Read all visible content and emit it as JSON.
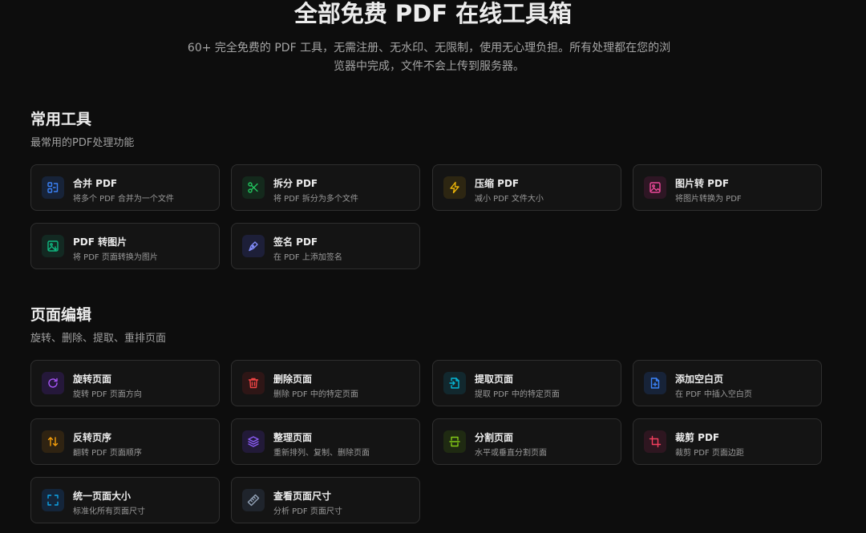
{
  "hero": {
    "title": "全部免费 PDF 在线工具箱",
    "subtitle_line1": "60+ 完全免费的 PDF 工具，无需注册、无水印、无限制，使用无心理负担。所有处理都在您的浏",
    "subtitle_line2": "览器中完成，文件不会上传到服务器。"
  },
  "sections": [
    {
      "title": "常用工具",
      "desc": "最常用的PDF处理功能",
      "tools": [
        {
          "name": "合并 PDF",
          "desc": "将多个 PDF 合并为一个文件",
          "icon": "merge-icon",
          "color": "#3b82f6",
          "bg": "#172338"
        },
        {
          "name": "拆分 PDF",
          "desc": "将 PDF 拆分为多个文件",
          "icon": "scissors-icon",
          "color": "#22c55e",
          "bg": "#14291c"
        },
        {
          "name": "压缩 PDF",
          "desc": "减小 PDF 文件大小",
          "icon": "lightning-icon",
          "color": "#eab308",
          "bg": "#2d2612"
        },
        {
          "name": "图片转 PDF",
          "desc": "将图片转换为 PDF",
          "icon": "image-icon",
          "color": "#ec4899",
          "bg": "#2e1624"
        },
        {
          "name": "PDF 转图片",
          "desc": "将 PDF 页面转换为图片",
          "icon": "image-export-icon",
          "color": "#10b981",
          "bg": "#132922"
        },
        {
          "name": "签名 PDF",
          "desc": "在 PDF 上添加签名",
          "icon": "pen-icon",
          "color": "#818cf8",
          "bg": "#1d1f38"
        }
      ]
    },
    {
      "title": "页面编辑",
      "desc": "旋转、删除、提取、重排页面",
      "tools": [
        {
          "name": "旋转页面",
          "desc": "旋转 PDF 页面方向",
          "icon": "rotate-icon",
          "color": "#a855f7",
          "bg": "#25183a"
        },
        {
          "name": "删除页面",
          "desc": "删除 PDF 中的特定页面",
          "icon": "trash-icon",
          "color": "#ef4444",
          "bg": "#2e1616"
        },
        {
          "name": "提取页面",
          "desc": "提取 PDF 中的特定页面",
          "icon": "file-export-icon",
          "color": "#06b6d4",
          "bg": "#12282e"
        },
        {
          "name": "添加空白页",
          "desc": "在 PDF 中插入空白页",
          "icon": "file-plus-icon",
          "color": "#3b82f6",
          "bg": "#172338"
        },
        {
          "name": "反转页序",
          "desc": "翻转 PDF 页面顺序",
          "icon": "reverse-order-icon",
          "color": "#f59e0b",
          "bg": "#2f2312"
        },
        {
          "name": "整理页面",
          "desc": "重新排列、复制、删除页面",
          "icon": "layers-icon",
          "color": "#8b5cf6",
          "bg": "#221a38"
        },
        {
          "name": "分割页面",
          "desc": "水平或垂直分割页面",
          "icon": "split-page-icon",
          "color": "#84cc16",
          "bg": "#1f2a12"
        },
        {
          "name": "裁剪 PDF",
          "desc": "裁剪 PDF 页面边距",
          "icon": "crop-icon",
          "color": "#f43f5e",
          "bg": "#2e1620"
        },
        {
          "name": "统一页面大小",
          "desc": "标准化所有页面尺寸",
          "icon": "expand-icon",
          "color": "#0ea5e9",
          "bg": "#14253a"
        },
        {
          "name": "查看页面尺寸",
          "desc": "分析 PDF 页面尺寸",
          "icon": "ruler-icon",
          "color": "#94a3b8",
          "bg": "#1f242c"
        }
      ]
    }
  ]
}
